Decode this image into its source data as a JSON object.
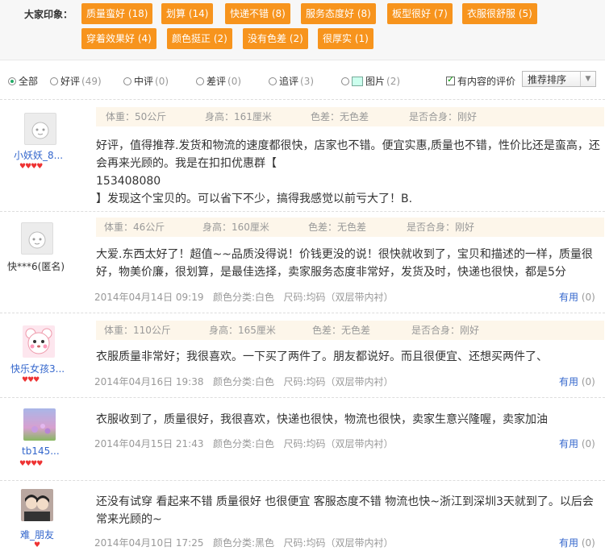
{
  "impressions": {
    "label": "大家印象：",
    "tags": [
      {
        "text": "质量蛮好 (18)"
      },
      {
        "text": "划算 (14)"
      },
      {
        "text": "快递不错 (8)"
      },
      {
        "text": "服务态度好 (8)"
      },
      {
        "text": "板型很好 (7)"
      },
      {
        "text": "衣服很舒服 (5)"
      },
      {
        "text": "穿着效果好 (4)"
      },
      {
        "text": "颜色挺正 (2)"
      },
      {
        "text": "没有色差 (2)"
      },
      {
        "text": "很厚实 (1)"
      }
    ]
  },
  "filters": {
    "all": "全部",
    "good": "好评",
    "good_count": "(49)",
    "mid": "中评",
    "mid_count": "(0)",
    "bad": "差评",
    "bad_count": "(0)",
    "followup": "追评",
    "followup_count": "(3)",
    "pic": "图片",
    "pic_count": "(2)",
    "has_content": "有内容的评价",
    "sort": "推荐排序"
  },
  "reviews": [
    {
      "user": "小妖妖_8...",
      "meta": {
        "weight": "体重：50公斤",
        "height": "身高：161厘米",
        "color_diff": "色差：无色差",
        "fit": "是否合身：刚好"
      },
      "text": [
        "好评，值得推荐.发货和物流的速度都很快，店家也不错。便宜实惠,质量也不错，性价比还是蛮高，还",
        "会再来光顾的。我是在扣扣优惠群【",
        "153408080",
        "】发现这个宝贝的。可以省下不少，搞得我感觉以前亏大了！B."
      ]
    },
    {
      "user": "快***6(匿名)",
      "meta": {
        "weight": "体重：46公斤",
        "height": "身高：160厘米",
        "color_diff": "色差：无色差",
        "fit": "是否合身：刚好"
      },
      "text": [
        "大爱.东西太好了！超值~~品质没得说！价钱更没的说！很快就收到了，宝贝和描述的一样，质量很",
        "好，物美价廉，很划算，是最佳选择，卖家服务态度非常好，发货及时，快递也很快，都是5分"
      ],
      "date": "2014年04月14日 09:19",
      "color": "颜色分类:白色",
      "size": "尺码:均码（双层带内衬）",
      "helpful": "有用",
      "helpful_count": "(0)"
    },
    {
      "user": "快乐女孩3...",
      "meta": {
        "weight": "体重：110公斤",
        "height": "身高：165厘米",
        "color_diff": "色差：无色差",
        "fit": "是否合身：刚好"
      },
      "text": [
        "衣服质量非常好；我很喜欢。一下买了两件了。朋友都说好。而且很便宜、还想买两件了、"
      ],
      "date": "2014年04月16日 19:38",
      "color": "颜色分类:白色",
      "size": "尺码:均码（双层带内衬）",
      "helpful": "有用",
      "helpful_count": "(0)"
    },
    {
      "user": "tb145...",
      "text": [
        "衣服收到了，质量很好，我很喜欢，快递也很快，物流也很快，卖家生意兴隆喔，卖家加油"
      ],
      "date": "2014年04月15日 21:43",
      "color": "颜色分类:白色",
      "size": "尺码:均码（双层带内衬）",
      "helpful": "有用",
      "helpful_count": "(0)"
    },
    {
      "user": "难_朋友",
      "text": [
        "还没有试穿 看起来不错 质量很好 也很便宜 客服态度不错 物流也快~浙江到深圳3天就到了。以后会",
        "常来光顾的~"
      ],
      "date": "2014年04月10日 17:25",
      "color": "颜色分类:黑色",
      "size": "尺码:均码（双层带内衬）",
      "helpful": "有用",
      "helpful_count": "(0)"
    }
  ],
  "colors": {
    "tag_bg": "#f7941d",
    "link": "#3366cc",
    "meta_bg": "#fdf6ea",
    "heart": "#ee3333"
  }
}
